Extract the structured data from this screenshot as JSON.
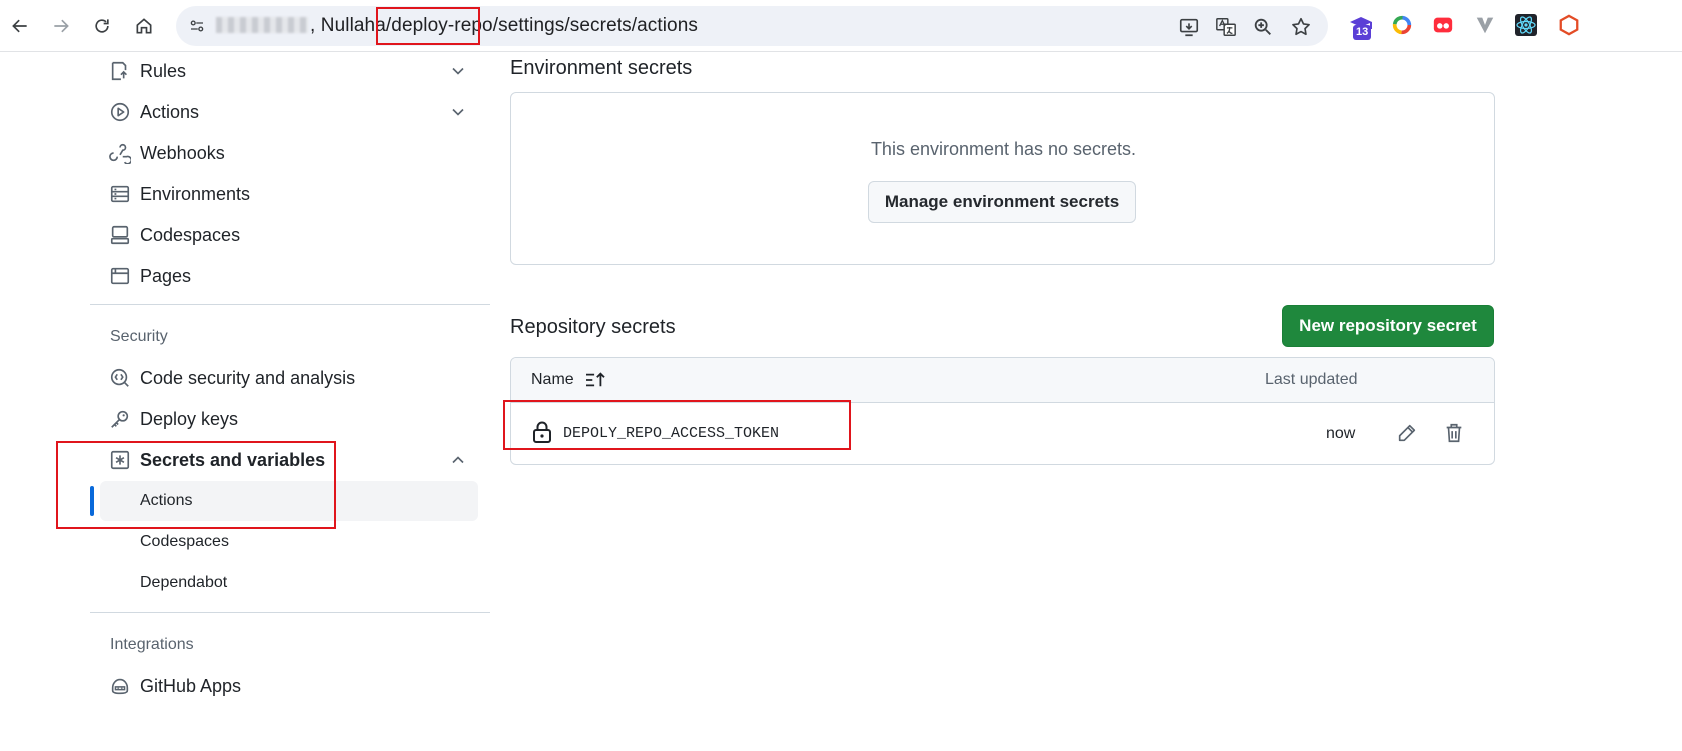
{
  "browser": {
    "url_host_suffix": ", Nullaha/",
    "url_repo": "deploy-repo",
    "url_path": "/settings/secrets/actions",
    "extension_badge": "13"
  },
  "sidebar": {
    "top_items": [
      {
        "label": "Rules",
        "icon": "rules-icon",
        "expandable": true
      },
      {
        "label": "Actions",
        "icon": "play-icon",
        "expandable": true
      },
      {
        "label": "Webhooks",
        "icon": "webhook-icon"
      },
      {
        "label": "Environments",
        "icon": "server-icon"
      },
      {
        "label": "Codespaces",
        "icon": "codespaces-icon"
      },
      {
        "label": "Pages",
        "icon": "browser-icon"
      }
    ],
    "security_heading": "Security",
    "security_items": [
      {
        "label": "Code security and analysis",
        "icon": "codescan-icon"
      },
      {
        "label": "Deploy keys",
        "icon": "key-icon"
      },
      {
        "label": "Secrets and variables",
        "icon": "asterisk-icon",
        "expanded": true
      }
    ],
    "secrets_subitems": [
      {
        "label": "Actions",
        "active": true
      },
      {
        "label": "Codespaces"
      },
      {
        "label": "Dependabot"
      }
    ],
    "integrations_heading": "Integrations",
    "integrations_items": [
      {
        "label": "GitHub Apps",
        "icon": "apps-icon"
      }
    ]
  },
  "main": {
    "env_title": "Environment secrets",
    "env_empty": "This environment has no secrets.",
    "env_manage_button": "Manage environment secrets",
    "repo_title": "Repository secrets",
    "new_secret_button": "New repository secret",
    "table": {
      "col_name": "Name",
      "col_updated": "Last updated",
      "rows": [
        {
          "name": "DEPOLY_REPO_ACCESS_TOKEN",
          "updated": "now"
        }
      ]
    }
  },
  "colors": {
    "accent": "#0969da",
    "primary_button": "#1f883d",
    "highlight_box": "#e0151c"
  }
}
